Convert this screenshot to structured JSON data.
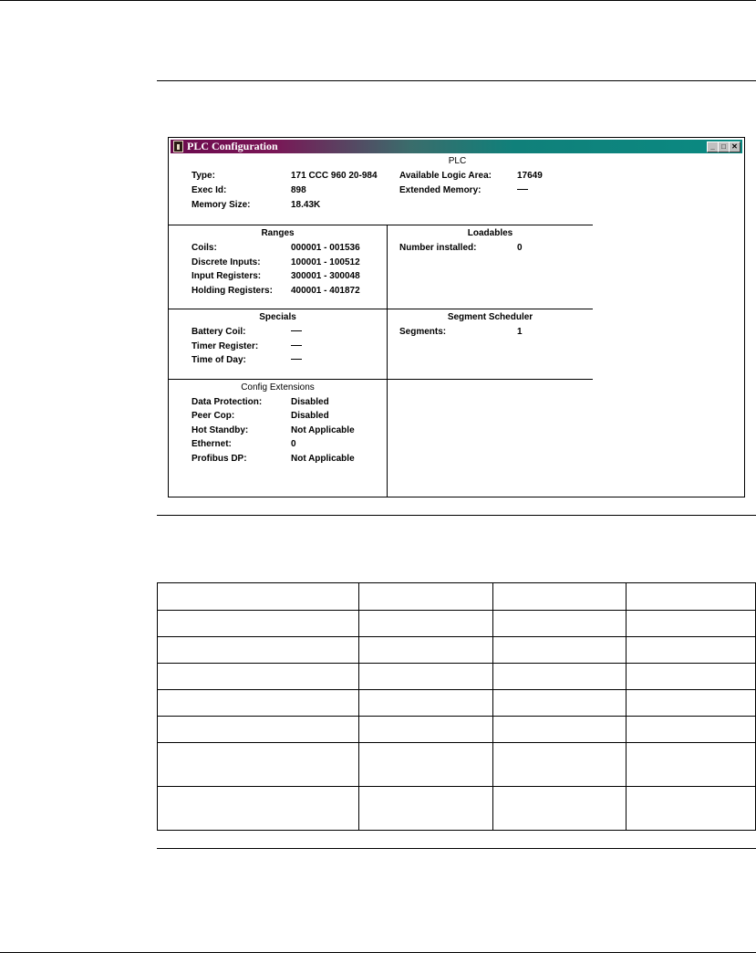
{
  "window": {
    "title": "PLC Configuration",
    "controls": [
      "_",
      "□",
      "✕"
    ]
  },
  "plc": {
    "heading": "PLC",
    "type_label": "Type:",
    "type_value": "171 CCC 960 20-984",
    "exec_label": "Exec Id:",
    "exec_value": "898",
    "mem_label": "Memory Size:",
    "mem_value": "18.43K",
    "logic_label": "Available Logic Area:",
    "logic_value": "17649",
    "ext_label": "Extended Memory:"
  },
  "ranges": {
    "heading": "Ranges",
    "rows": [
      {
        "label": "Coils:",
        "value": "000001 - 001536"
      },
      {
        "label": "Discrete Inputs:",
        "value": "100001 - 100512"
      },
      {
        "label": "Input Registers:",
        "value": "300001 - 300048"
      },
      {
        "label": "Holding Registers:",
        "value": "400001 - 401872"
      }
    ]
  },
  "loadables": {
    "heading": "Loadables",
    "label": "Number installed:",
    "value": "0"
  },
  "specials": {
    "heading": "Specials",
    "battery_label": "Battery Coil:",
    "timer_label": "Timer Register:",
    "tod_label": "Time of Day:"
  },
  "segment": {
    "heading": "Segment Scheduler",
    "label": "Segments:",
    "value": "1"
  },
  "config_ext": {
    "heading": "Config Extensions",
    "rows": [
      {
        "label": "Data Protection:",
        "value": "Disabled"
      },
      {
        "label": "Peer Cop:",
        "value": "Disabled"
      },
      {
        "label": "Hot Standby:",
        "value": "Not Applicable"
      },
      {
        "label": "Ethernet:",
        "value": "0"
      },
      {
        "label": "Profibus DP:",
        "value": "Not Applicable"
      }
    ]
  }
}
